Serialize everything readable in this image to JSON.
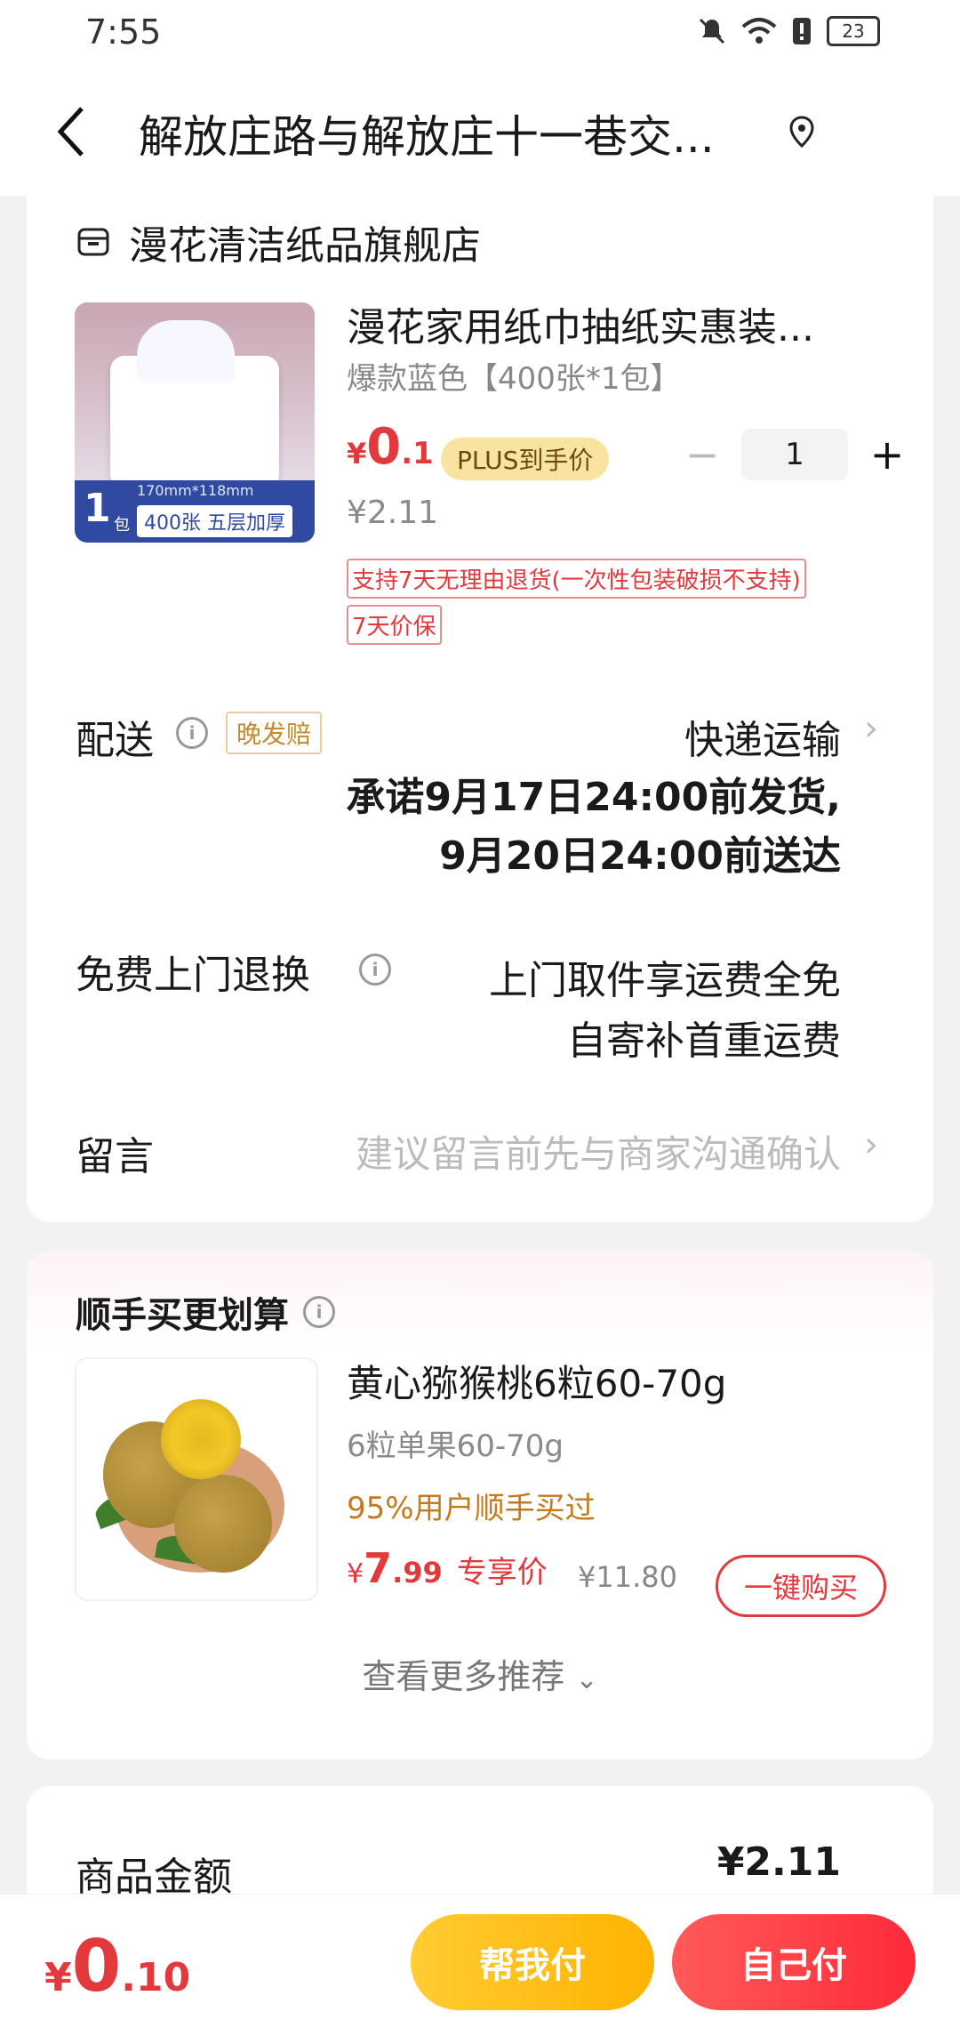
{
  "status": {
    "time": "7:55",
    "battery": "23"
  },
  "header": {
    "address": "解放庄路与解放庄十一巷交..."
  },
  "store": {
    "name": "漫花清洁纸品旗舰店"
  },
  "product": {
    "image_text_count": "1",
    "image_text_pack": "包",
    "image_text_size": "170mm*118mm",
    "image_text_desc": "400张 五层加厚",
    "title": "漫花家用纸巾抽纸实惠装...",
    "spec": "爆款蓝色【400张*1包】",
    "price_currency": "¥",
    "price_int": "0",
    "price_dec": ".1",
    "plus_tag": "PLUS到手价",
    "original_price": "¥2.11",
    "quantity": "1",
    "tag_return": "支持7天无理由退货(一次性包装破损不支持)",
    "tag_price_protect": "7天价保"
  },
  "delivery": {
    "label": "配送",
    "late_tag": "晚发赔",
    "method": "快递运输",
    "promise_line1": "承诺9月17日24:00前发货,",
    "promise_line2": "9月20日24:00前送达"
  },
  "return_service": {
    "label": "免费上门退换",
    "line1": "上门取件享运费全免",
    "line2": "自寄补首重运费"
  },
  "message": {
    "label": "留言",
    "placeholder": "建议留言前先与商家沟通确认"
  },
  "upsell": {
    "title": "顺手买更划算",
    "item_title": "黄心猕猴桃6粒60-70g",
    "item_spec": "6粒单果60-70g",
    "bought_text": "95%用户顺手买过",
    "price_currency": "¥",
    "price_int": "7",
    "price_dec": ".99",
    "price_label": "专享价",
    "original_price": "¥11.80",
    "buy_button": "一键购买",
    "more": "查看更多推荐"
  },
  "summary": {
    "label": "商品金额",
    "value": "¥2.11"
  },
  "bottom": {
    "currency": "¥",
    "total_int": "0",
    "total_dec": ".10",
    "help_pay": "帮我付",
    "self_pay": "自己付"
  },
  "colors": {
    "accent_red": "#e4393c",
    "gold": "#ffb300"
  }
}
